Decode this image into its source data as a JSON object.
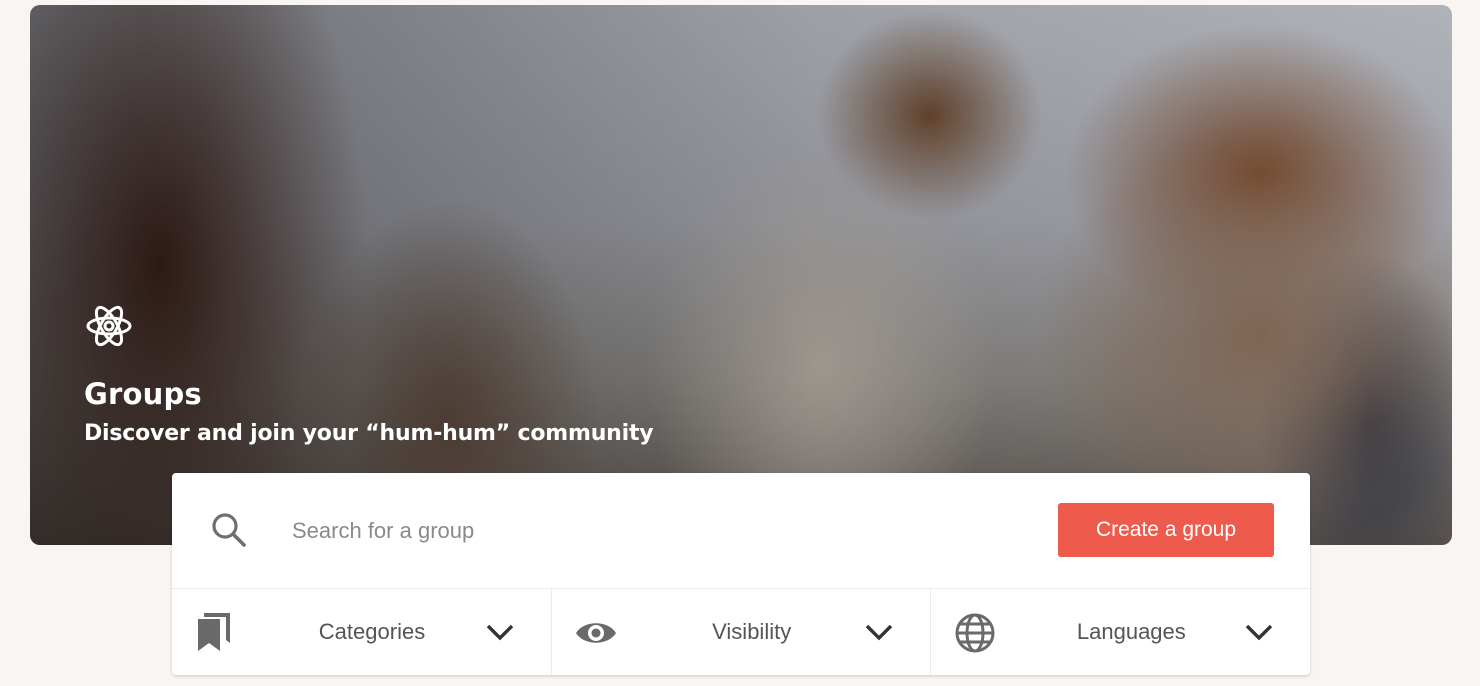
{
  "hero": {
    "icon": "atom-icon",
    "title": "Groups",
    "subtitle": "Discover and join your “hum-hum” community"
  },
  "search": {
    "placeholder": "Search for a group",
    "value": "",
    "icon": "search-icon"
  },
  "create_button": {
    "label": "Create a group",
    "color": "#ee5b4d"
  },
  "filters": [
    {
      "label": "Categories",
      "icon": "bookmarks-icon"
    },
    {
      "label": "Visibility",
      "icon": "eye-icon"
    },
    {
      "label": "Languages",
      "icon": "globe-icon"
    }
  ]
}
